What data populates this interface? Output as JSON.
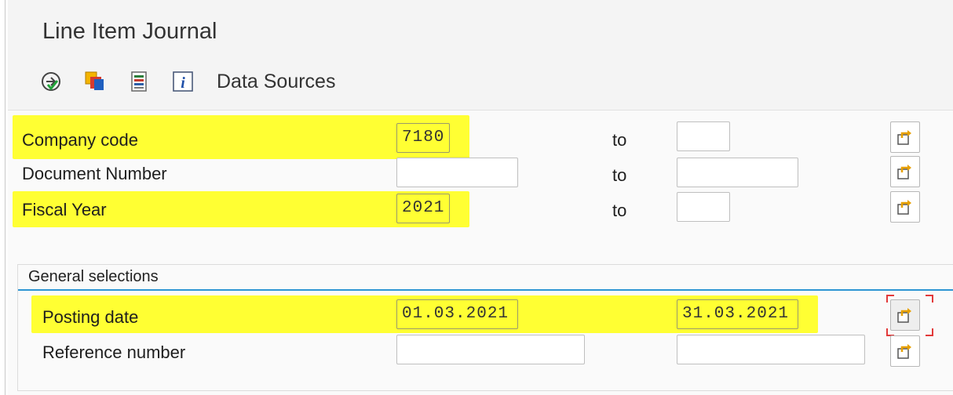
{
  "window": {
    "title": "Line Item Journal"
  },
  "toolbar": {
    "items": [
      {
        "icon": "execute-icon"
      },
      {
        "icon": "copy-variant-icon"
      },
      {
        "icon": "list-icon"
      },
      {
        "icon": "info-icon"
      }
    ],
    "data_sources_label": "Data Sources"
  },
  "selection": {
    "to_label": "to",
    "rows": [
      {
        "label": "Company code",
        "from": "7180",
        "to": "",
        "highlighted": true
      },
      {
        "label": "Document Number",
        "from": "",
        "to": "",
        "highlighted": false
      },
      {
        "label": "Fiscal Year",
        "from": "2021",
        "to": "",
        "highlighted": true
      }
    ]
  },
  "general_selections": {
    "title": "General selections",
    "rows": [
      {
        "label": "Posting date",
        "from": "01.03.2021",
        "to": "31.03.2021",
        "highlighted": true
      },
      {
        "label": "Reference number",
        "from": "",
        "to": "",
        "highlighted": false
      }
    ]
  },
  "colors": {
    "highlight": "#ffff33",
    "group_line": "#2e95d3",
    "focus_corner": "#e23a3a"
  }
}
